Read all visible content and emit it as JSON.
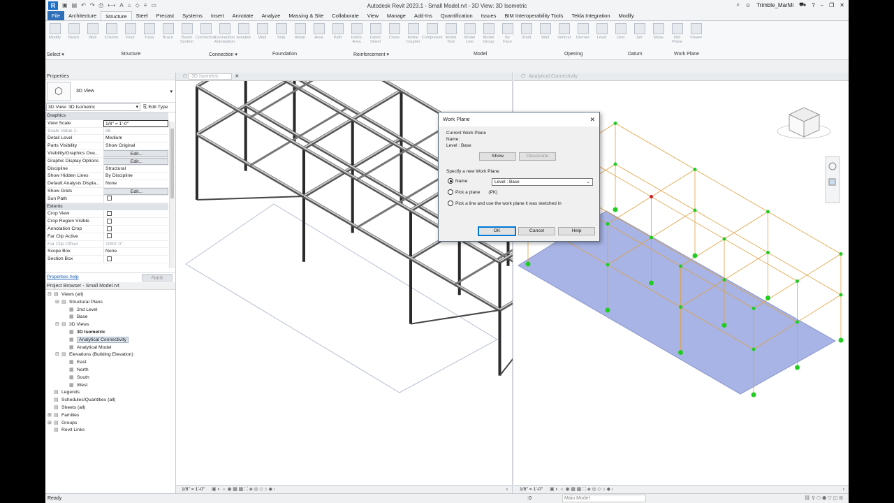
{
  "titlebar": {
    "title": "Autodesk Revit 2023.1 - Small Model.rvt - 3D View: 3D Isometric",
    "user": "Trimble_MarMi"
  },
  "tabs": [
    "File",
    "Architecture",
    "Structure",
    "Steel",
    "Precast",
    "Systems",
    "Insert",
    "Annotate",
    "Analyze",
    "Massing & Site",
    "Collaborate",
    "View",
    "Manage",
    "Add-Ins",
    "Quantification",
    "Issues",
    "BIM Interoperability Tools",
    "Tekla Integration",
    "Modify"
  ],
  "active_tab": "Structure",
  "ribbon": {
    "tools": [
      "Modify",
      "Beam",
      "Wall",
      "Column",
      "Floor",
      "Truss",
      "Brace",
      "Beam\nSystem",
      "Connection",
      "Connection\nAutomation",
      "Isolated",
      "Wall",
      "Slab",
      "Rebar",
      "Area",
      "Path",
      "Fabric\nArea",
      "Fabric\nSheet",
      "Cover",
      "Rebar\nCoupler",
      "Component",
      "Model\nText",
      "Model\nLine",
      "Model\nGroup",
      "By\nFace",
      "Shaft",
      "Wall",
      "Vertical",
      "Dormer",
      "Level",
      "Grid",
      "Set",
      "Show",
      "Ref\nPlane",
      "Viewer"
    ],
    "panels": [
      "Select ▾",
      "Structure",
      "Connection ▾",
      "Foundation",
      "Reinforcement ▾",
      "Model",
      "Opening",
      "Datum",
      "Work Plane"
    ]
  },
  "properties": {
    "header": "Properties",
    "type_name": "3D View",
    "instance_selector": "3D View: 3D Isometric",
    "edit_type": "Edit Type",
    "groups": [
      {
        "name": "Graphics",
        "rows": [
          {
            "k": "View Scale",
            "v": "1/8\" = 1'-0\"",
            "style": "input"
          },
          {
            "k": "Scale Value    1:",
            "v": "96",
            "style": "grey"
          },
          {
            "k": "Detail Level",
            "v": "Medium"
          },
          {
            "k": "Parts Visibility",
            "v": "Show Original"
          },
          {
            "k": "Visibility/Graphics Ove...",
            "v": "Edit...",
            "style": "btn"
          },
          {
            "k": "Graphic Display Options",
            "v": "Edit...",
            "style": "btn"
          },
          {
            "k": "Discipline",
            "v": "Structural"
          },
          {
            "k": "Show Hidden Lines",
            "v": "By Discipline"
          },
          {
            "k": "Default Analysis Displa...",
            "v": "None"
          },
          {
            "k": "Show Grids",
            "v": "Edit...",
            "style": "btn"
          },
          {
            "k": "Sun Path",
            "v": "",
            "style": "chk"
          }
        ]
      },
      {
        "name": "Extents",
        "rows": [
          {
            "k": "Crop View",
            "v": "",
            "style": "chk"
          },
          {
            "k": "Crop Region Visible",
            "v": "",
            "style": "chk"
          },
          {
            "k": "Annotation Crop",
            "v": "",
            "style": "chk"
          },
          {
            "k": "Far Clip Active",
            "v": "",
            "style": "chk"
          },
          {
            "k": "Far Clip Offset",
            "v": "1000'  0\"",
            "style": "grey"
          },
          {
            "k": "Scope Box",
            "v": "None"
          },
          {
            "k": "Section Box",
            "v": "",
            "style": "chk"
          }
        ]
      }
    ],
    "help": "Properties help",
    "apply": "Apply"
  },
  "browser": {
    "header": "Project Browser - Small Model.rvt",
    "items": [
      {
        "t": "Views (all)",
        "lvl": 0,
        "exp": "⊟"
      },
      {
        "t": "Structural Plans",
        "lvl": 1,
        "exp": "⊟"
      },
      {
        "t": "2nd Level",
        "lvl": 2
      },
      {
        "t": "Base",
        "lvl": 2
      },
      {
        "t": "3D Views",
        "lvl": 1,
        "exp": "⊟"
      },
      {
        "t": "3D Isometric",
        "lvl": 2,
        "bold": true
      },
      {
        "t": "Analytical Connectivity",
        "lvl": 2,
        "sel": true
      },
      {
        "t": "Analytical Model",
        "lvl": 2
      },
      {
        "t": "Elevations (Building Elevation)",
        "lvl": 1,
        "exp": "⊟"
      },
      {
        "t": "East",
        "lvl": 2
      },
      {
        "t": "North",
        "lvl": 2
      },
      {
        "t": "South",
        "lvl": 2
      },
      {
        "t": "West",
        "lvl": 2
      },
      {
        "t": "Legends",
        "lvl": 0
      },
      {
        "t": "Schedules/Quantities (all)",
        "lvl": 0
      },
      {
        "t": "Sheets (all)",
        "lvl": 0
      },
      {
        "t": "Families",
        "lvl": 0,
        "exp": "⊞"
      },
      {
        "t": "Groups",
        "lvl": 0,
        "exp": "⊞"
      },
      {
        "t": "Revit Links",
        "lvl": 0
      }
    ]
  },
  "view1": {
    "tab": "3D Isometric",
    "scale": "1/8\" = 1'-0\""
  },
  "view2": {
    "tab": "Analytical Connectivity",
    "scale": "1/8\" = 1'-0\""
  },
  "dialog": {
    "title": "Work Plane",
    "current_label": "Current Work Plane",
    "name_label": "Name:",
    "name_value": "Level : Base",
    "show": "Show",
    "dissociate": "Dissociate",
    "specify": "Specify a new Work Plane",
    "opt_name": "Name",
    "name_select": "Level : Base",
    "opt_pick_plane": "Pick a plane",
    "pk": "(PK)",
    "opt_pick_line": "Pick a line and use the work plane it was sketched in",
    "ok": "OK",
    "cancel": "Cancel",
    "help": "Help"
  },
  "status": {
    "text": "Ready",
    "zero": ":0",
    "model": "Main Model"
  },
  "colors": {
    "accent": "#2f6fb7",
    "node_green": "#22cc22",
    "node_red": "#cc2222",
    "plane_blue": "#a8b4e6",
    "member_orange": "#e0a040"
  }
}
